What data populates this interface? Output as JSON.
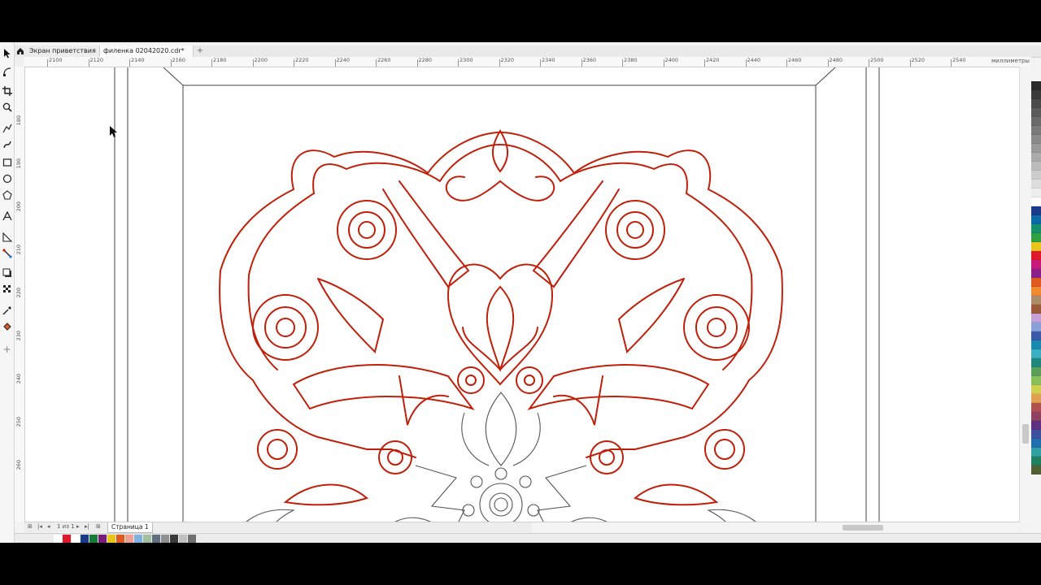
{
  "tabs": {
    "welcome": "Экран приветствия",
    "document": "филенка 02042020.cdr*",
    "add": "+"
  },
  "ruler": {
    "units": "миллиметры",
    "h_labels": [
      "2100",
      "2120",
      "2140",
      "2160",
      "2180",
      "2200",
      "2220",
      "2240",
      "2260",
      "2280",
      "2300",
      "2320",
      "2340",
      "2360",
      "2380",
      "2400",
      "2420",
      "2440",
      "2460",
      "2480",
      "2500",
      "2520",
      "2540"
    ],
    "v_labels": [
      "180",
      "190",
      "200",
      "210",
      "220",
      "230",
      "240",
      "250",
      "260"
    ]
  },
  "pagebar": {
    "page_of": "1 из 1",
    "page_tab": "Страница 1"
  },
  "toolbox": {
    "icons": [
      "pick-tool-icon",
      "shape-tool-icon",
      "crop-tool-icon",
      "zoom-tool-icon",
      "freehand-tool-icon",
      "artistic-media-icon",
      "rectangle-tool-icon",
      "ellipse-tool-icon",
      "polygon-tool-icon",
      "text-tool-icon",
      "dimension-tool-icon",
      "connector-tool-icon",
      "drop-shadow-icon",
      "transparency-icon",
      "eyedropper-icon",
      "fill-tool-icon",
      "add-tool-icon"
    ]
  },
  "colors": {
    "ornament": "#c0200a",
    "outline": "#555555",
    "accent": "#1f6fd6"
  },
  "palette": [
    "#2a2a2a",
    "#3a3a3a",
    "#4a4a4a",
    "#5a5a5a",
    "#6a6a6a",
    "#7a7a7a",
    "#8a8a8a",
    "#9a9a9a",
    "#aaaaaa",
    "#bbbbbb",
    "#cccccc",
    "#dddddd",
    "#eeeeee",
    "#ffffff",
    "#1a3a8a",
    "#0c6aa6",
    "#168f6a",
    "#2fa040",
    "#e8c51a",
    "#e0192a",
    "#c7197a",
    "#8a1f8a",
    "#e05a20",
    "#f08a30",
    "#ad8a6a",
    "#9a5a3a",
    "#c6a0d8",
    "#8aa0d8",
    "#3a5aa8",
    "#1a8ab0",
    "#3ab0c0",
    "#20887a",
    "#5aa05a",
    "#8ac05a",
    "#d0d050",
    "#e0a050",
    "#b05050",
    "#904060",
    "#603080",
    "#4050a0",
    "#2070b0",
    "#30a0a0",
    "#208060",
    "#506030"
  ],
  "doc_palette": [
    "#ffffff",
    "#e0192a",
    "#ffffff",
    "#1a3a8a",
    "#1a7a3a",
    "#7a1a7a",
    "#e8c51a",
    "#e05a20",
    "#f0a090",
    "#80b0e0",
    "#a0c0a0",
    "#607080",
    "#909090",
    "#3a3a3a",
    "#c0c0c0",
    "#707070"
  ]
}
